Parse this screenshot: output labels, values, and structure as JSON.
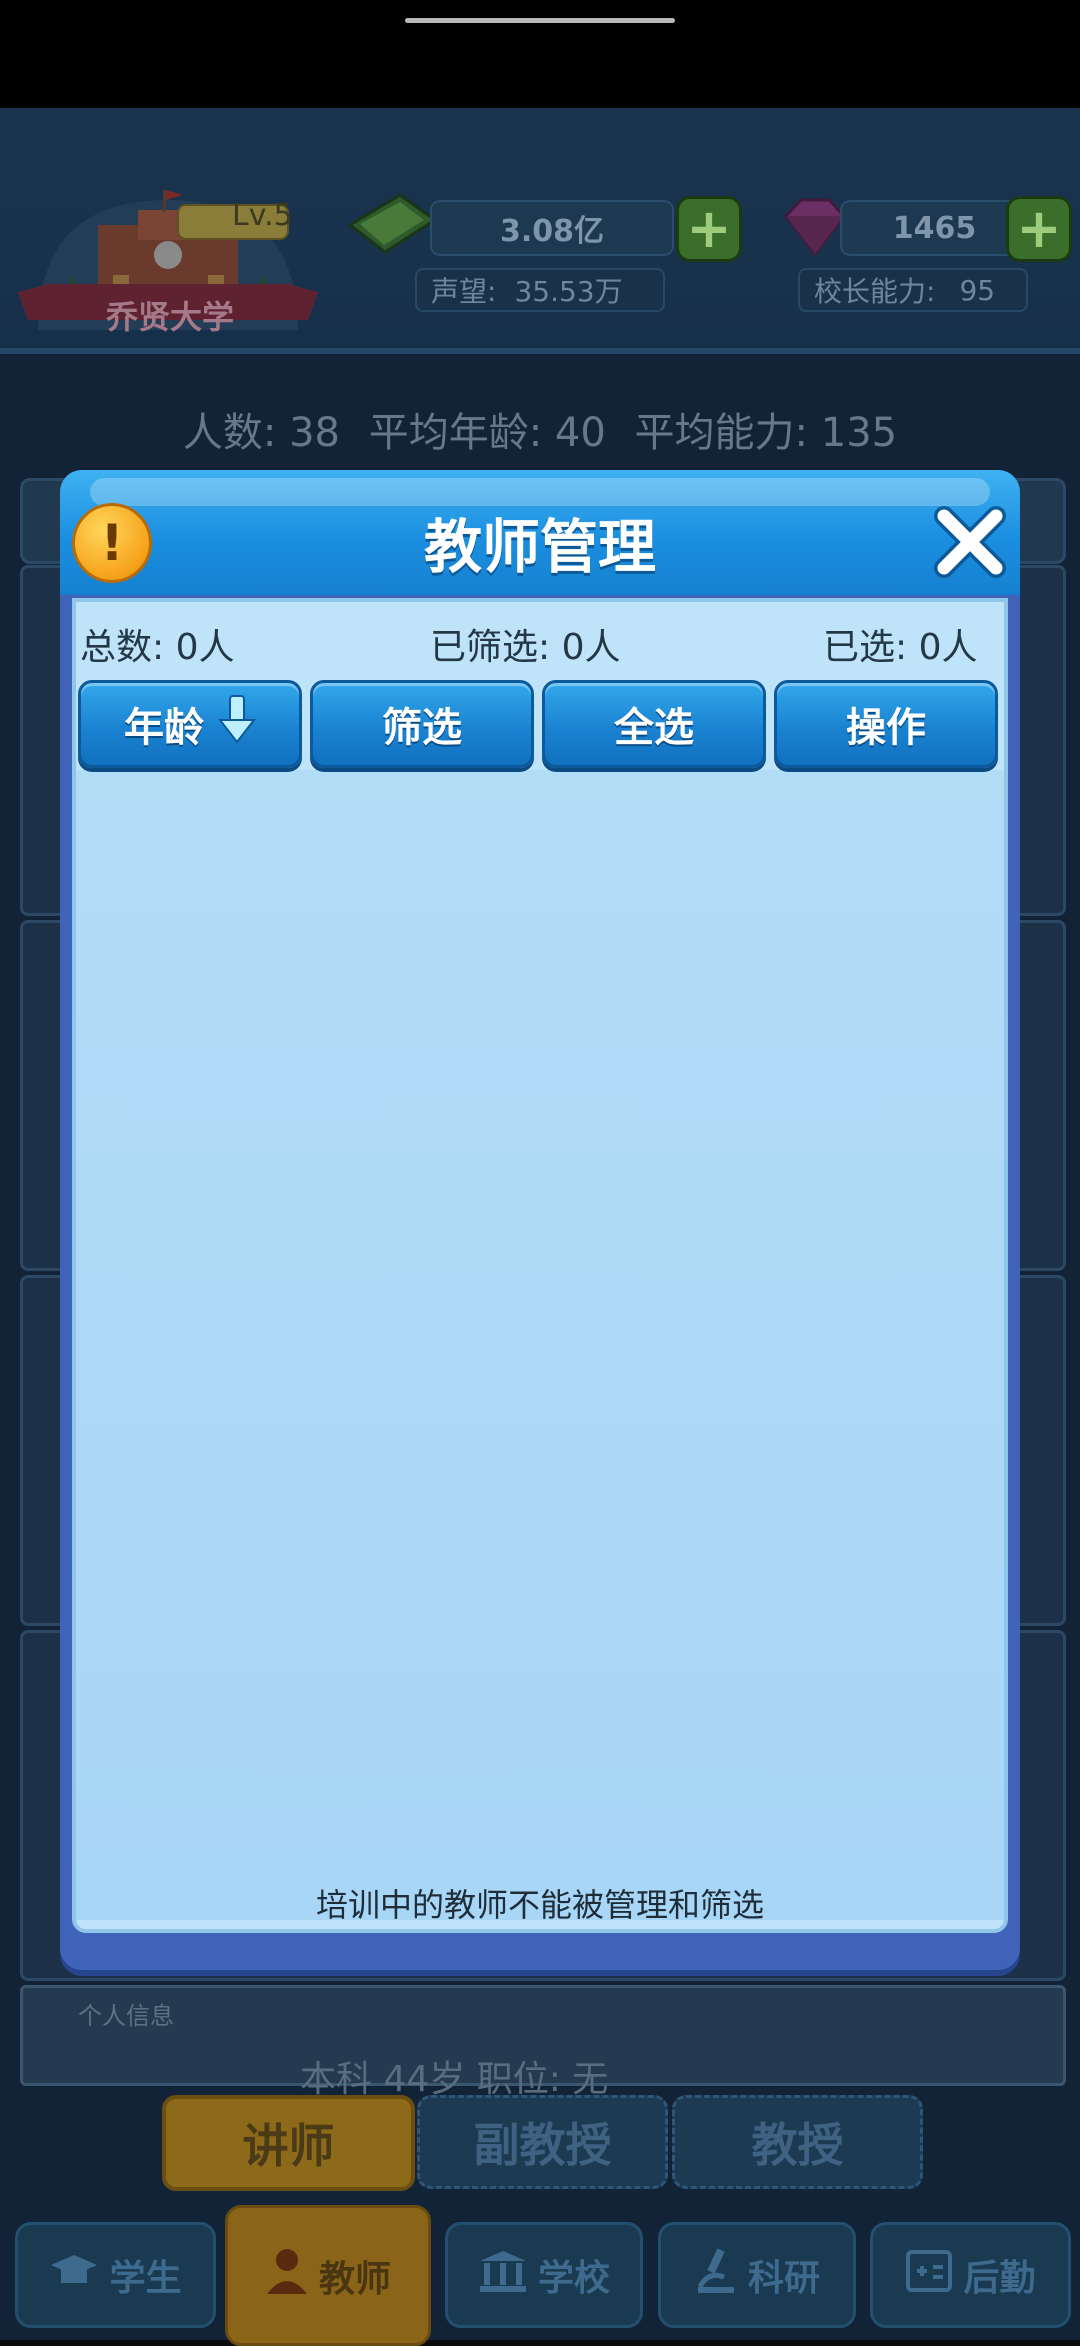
{
  "hud": {
    "school_name": "乔贤大学",
    "school_level": "Lv.5",
    "money": "3.08亿",
    "gems": "1465",
    "reputation_label": "声望:",
    "reputation_value": "35.53万",
    "principal_label": "校长能力:",
    "principal_value": "95"
  },
  "stats": {
    "headcount_label": "人数:",
    "headcount": "38",
    "avg_age_label": "平均年龄:",
    "avg_age": "40",
    "avg_ability_label": "平均能力:",
    "avg_ability": "135"
  },
  "background": {
    "personal_info_title": "个人信息",
    "personal_info_preview": "本科   44岁            职位: 无"
  },
  "rank_tabs": [
    "讲师",
    "副教授",
    "教授"
  ],
  "nav": {
    "student": "学生",
    "teacher": "教师",
    "school": "学校",
    "research": "科研",
    "logistics": "后勤"
  },
  "dialog": {
    "title": "教师管理",
    "total_label": "总数: 0人",
    "filtered_label": "已筛选: 0人",
    "selected_label": "已选: 0人",
    "buttons": {
      "age": "年龄",
      "filter": "筛选",
      "select_all": "全选",
      "operate": "操作"
    },
    "footer_note": "培训中的教师不能被管理和筛选"
  },
  "colors": {
    "dialog_header": "#1b8fe0",
    "dialog_body": "#b3dcf7",
    "button_blue": "#1a83d1",
    "alert_orange": "#f6a21b",
    "active_tab_gold": "#8d6a1a"
  }
}
